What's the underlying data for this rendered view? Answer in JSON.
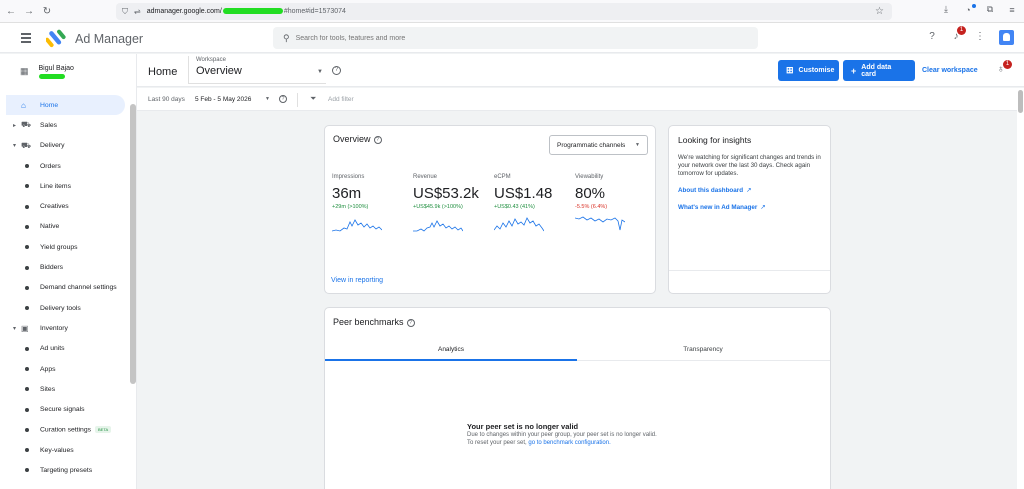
{
  "browser": {
    "url_host": "admanager.google.com/",
    "url_path": "#home#id=1573074"
  },
  "app": {
    "title": "Ad Manager",
    "search_placeholder": "Search for tools, features and more",
    "notification_count": "1"
  },
  "sidebar": {
    "network_name": "Bigul Bajao",
    "items": [
      {
        "label": "Home"
      },
      {
        "label": "Sales"
      },
      {
        "label": "Delivery"
      },
      {
        "label": "Orders"
      },
      {
        "label": "Line items"
      },
      {
        "label": "Creatives"
      },
      {
        "label": "Native"
      },
      {
        "label": "Yield groups"
      },
      {
        "label": "Bidders"
      },
      {
        "label": "Demand channel settings"
      },
      {
        "label": "Delivery tools"
      },
      {
        "label": "Inventory"
      },
      {
        "label": "Ad units"
      },
      {
        "label": "Apps"
      },
      {
        "label": "Sites"
      },
      {
        "label": "Secure signals"
      },
      {
        "label": "Curation settings",
        "badge": "BETA"
      },
      {
        "label": "Key-values"
      },
      {
        "label": "Targeting presets"
      }
    ]
  },
  "toolbar": {
    "home": "Home",
    "workspace_label": "Workspace",
    "workspace_value": "Overview",
    "customise": "Customise",
    "add_data_card": "Add data card",
    "clear_workspace": "Clear workspace",
    "insights_count": "1"
  },
  "filters": {
    "range_label": "Last 90 days",
    "range_value": "5 Feb - 5 May 2026",
    "add_filter": "Add filter"
  },
  "overview": {
    "title": "Overview",
    "channel_select": "Programmatic channels",
    "metrics": [
      {
        "label": "Impressions",
        "value": "36m",
        "delta": "+29m (>100%)",
        "trend": "pos"
      },
      {
        "label": "Revenue",
        "value": "US$53.2k",
        "delta": "+US$45.9k (>100%)",
        "trend": "pos"
      },
      {
        "label": "eCPM",
        "value": "US$1.48",
        "delta": "+US$0.43 (41%)",
        "trend": "pos"
      },
      {
        "label": "Viewability",
        "value": "80%",
        "delta": "-5.5% (6.4%)",
        "trend": "neg"
      }
    ],
    "view_link": "View in reporting"
  },
  "insights": {
    "title": "Looking for insights",
    "body": "We're watching for significant changes and trends in your network over the last 30 days. Check again tomorrow for updates.",
    "link1": "About this dashboard",
    "link2": "What's new in Ad Manager"
  },
  "peer": {
    "title": "Peer benchmarks",
    "tabs": [
      "Analytics",
      "Transparency"
    ],
    "empty_title": "Your peer set is no longer valid",
    "empty_line1": "Due to changes within your peer group, your peer set is no longer valid.",
    "empty_line2_prefix": "To reset your peer set,",
    "empty_line2_link": "go to benchmark configuration."
  },
  "colors": {
    "accent": "#1a73e8",
    "positive": "#1e8e3e",
    "negative": "#d93025",
    "sparkline": "#1a73e8"
  }
}
